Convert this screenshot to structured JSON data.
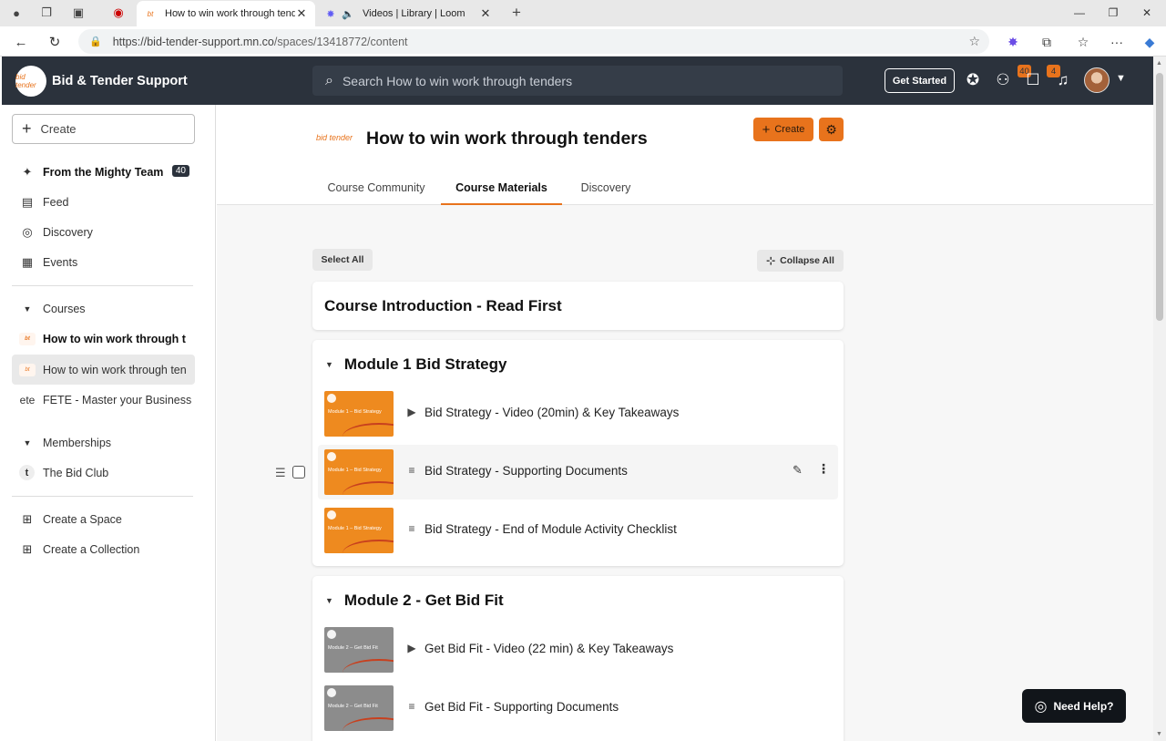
{
  "browser": {
    "tabs": [
      {
        "title": "How to win work through tenders",
        "active": true
      },
      {
        "title": "Videos | Library | Loom",
        "active": false
      }
    ],
    "url_host": "https://bid-tender-support.mn.co",
    "url_path": "/spaces/13418772/content"
  },
  "header": {
    "logo_text": "bid tender",
    "app_name": "Bid & Tender Support",
    "search_placeholder": "Search How to win work through tenders",
    "get_started": "Get Started",
    "people_badge": "40",
    "chat_badge": "4",
    "accent_color": "#e8731c",
    "header_bg": "#2b323c"
  },
  "sidebar": {
    "create_label": "Create",
    "from_team": {
      "label": "From the Mighty Team",
      "count": "40"
    },
    "nav": [
      {
        "label": "Feed",
        "icon": "feed-icon"
      },
      {
        "label": "Discovery",
        "icon": "compass-icon"
      },
      {
        "label": "Events",
        "icon": "calendar-icon"
      }
    ],
    "courses_header": "Courses",
    "courses": [
      {
        "label": "How to win work through t"
      },
      {
        "label": "How to win work through ten"
      },
      {
        "label": "FETE - Master your Business"
      }
    ],
    "fete_logo": "ete",
    "memberships_header": "Memberships",
    "memberships": [
      {
        "label": "The Bid Club",
        "initial": "t"
      }
    ],
    "actions": [
      {
        "label": "Create a Space"
      },
      {
        "label": "Create a Collection"
      }
    ]
  },
  "course": {
    "logo_text": "bid tender",
    "title": "How to win work through tenders",
    "create_label": "Create",
    "tabs": [
      "Course Community",
      "Course Materials",
      "Discovery"
    ],
    "active_tab": "Course Materials",
    "select_all": "Select All",
    "collapse_all": "Collapse All",
    "intro_section": "Course Introduction - Read First",
    "modules": [
      {
        "title": "Module 1 Bid Strategy",
        "thumb_label": "Module 1 – Bid Strategy",
        "thumb_color": "#ee8a1f",
        "lessons": [
          {
            "name": "Bid Strategy - Video (20min) & Key Takeaways",
            "type": "video"
          },
          {
            "name": "Bid Strategy - Supporting Documents",
            "type": "doc"
          },
          {
            "name": "Bid Strategy - End of Module Activity Checklist",
            "type": "doc"
          }
        ]
      },
      {
        "title": "Module 2 - Get Bid Fit",
        "thumb_label": "Module 2 – Get Bid Fit",
        "thumb_color": "#8c8c8c",
        "lessons": [
          {
            "name": "Get Bid Fit - Video (22 min) & Key Takeaways",
            "type": "video"
          },
          {
            "name": "Get Bid Fit - Supporting Documents",
            "type": "doc"
          }
        ]
      }
    ]
  },
  "help": {
    "label": "Need Help?"
  }
}
